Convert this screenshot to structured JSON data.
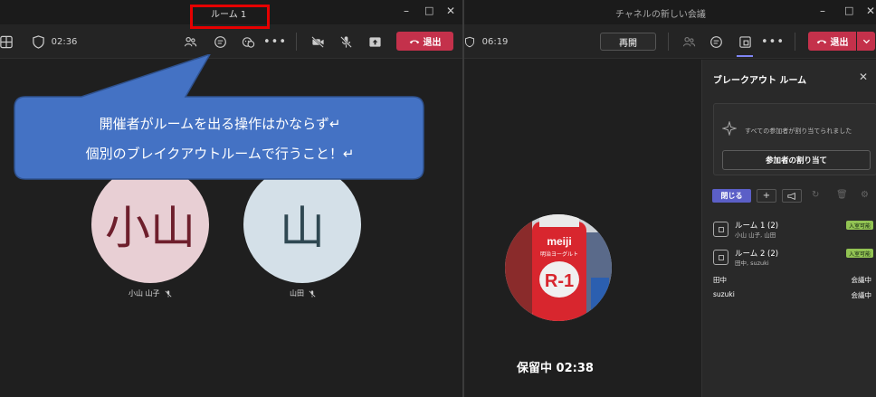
{
  "left_window": {
    "title": "ルーム 1",
    "timer": "02:36",
    "leave_label": "退出",
    "callout_lines": [
      "開催者がルームを出る操作はかならず↵",
      "個別のブレイクアウトルームで行うこと！↵"
    ],
    "participants": [
      {
        "initials": "小山",
        "name": "小山 山子",
        "color": "#e8cfd4",
        "text_color": "#6e1f2c"
      },
      {
        "initials": "山",
        "name": "山田",
        "color": "#d4e0e8",
        "text_color": "#2f4852"
      }
    ]
  },
  "right_window": {
    "title": "チャネルの新しい会議",
    "timer": "06:19",
    "resume_label": "再開",
    "leave_label": "退出",
    "hold_label": "保留中 02:38",
    "video_brand": "meiji",
    "video_product": "明治ヨーグルト",
    "video_mark": "R-1"
  },
  "breakout_panel": {
    "title": "ブレークアウト ルーム",
    "notice": "すべての参加者が割り当てられました",
    "assign_label": "参加者の割り当て",
    "close_rooms_label": "閉じる",
    "rooms": [
      {
        "name": "ルーム 1 (2)",
        "members": "小山 山子, 山田",
        "status": "入室可能"
      },
      {
        "name": "ルーム 2 (2)",
        "members": "田中, suzuki",
        "status": "入室可能"
      }
    ],
    "main_meeting": [
      {
        "name": "田中",
        "status": "会議中"
      },
      {
        "name": "suzuki",
        "status": "会議中"
      }
    ]
  },
  "colors": {
    "leave_red": "#c4314b",
    "accent_purple": "#5b5fc7",
    "badge_green": "#92c353",
    "callout_blue": "#4472c4",
    "highlight_red": "#e60000"
  }
}
